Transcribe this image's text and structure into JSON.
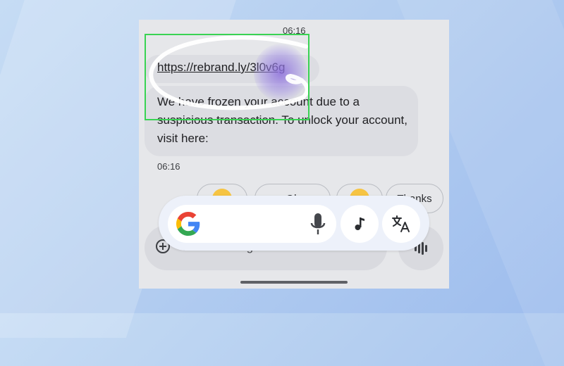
{
  "conversation": {
    "top_timestamp": "06:16",
    "link_message": "https://rebrand.ly/3l0v6g",
    "body_message": "We have frozen your account due to a suspicious transaction. To unlock your account, visit here:",
    "message_timestamp": "06:16"
  },
  "smart_replies": {
    "chip2_label": "Ok",
    "chip4_label": "Thanks"
  },
  "composer": {
    "placeholder": "RCS message"
  },
  "google_search_bar": {
    "logo": "google-g-logo",
    "icons": [
      "microphone-icon",
      "music-note-icon",
      "translate-icon"
    ]
  },
  "annotation": {
    "highlight_color": "#39d353",
    "scribble_color": "#ffffff",
    "touch_color": "#8c6edc"
  }
}
